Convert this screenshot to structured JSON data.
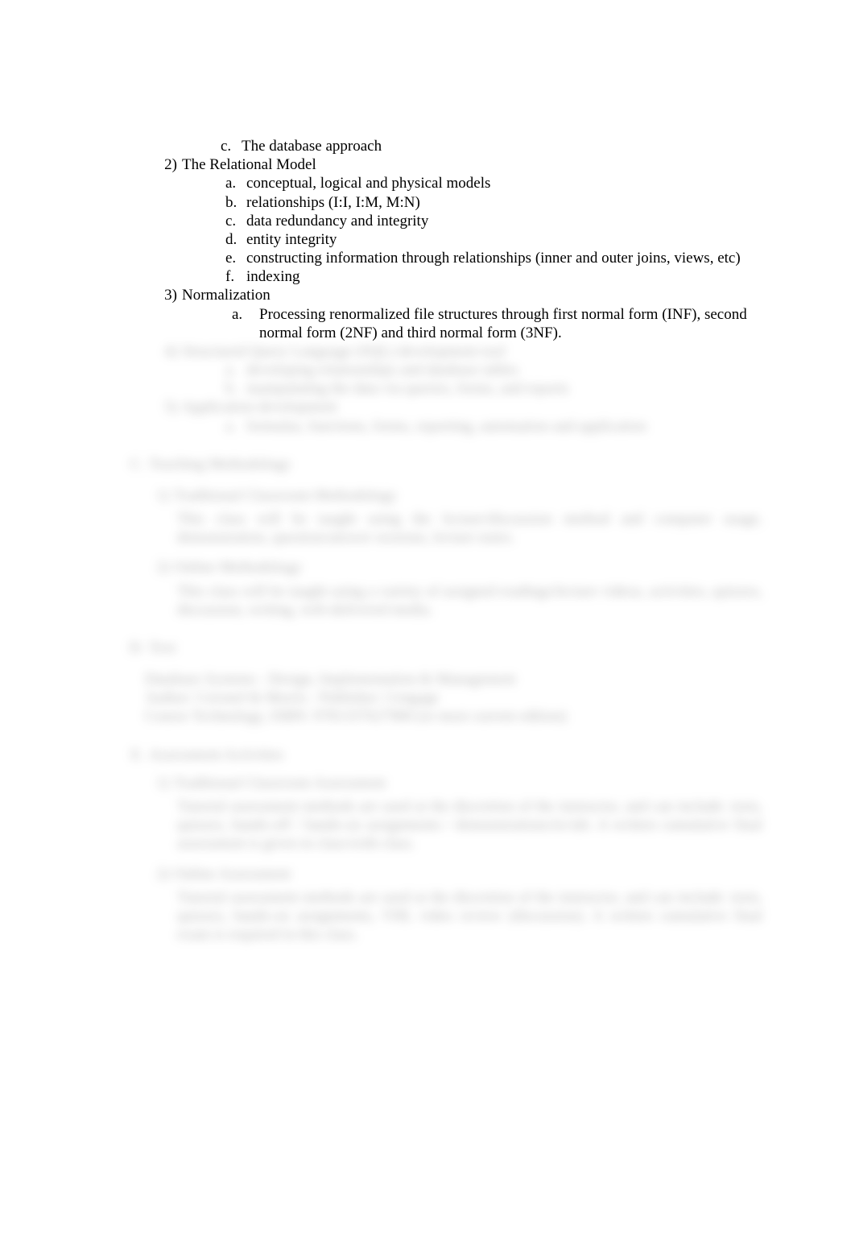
{
  "item1c": {
    "letter": "c.",
    "text": "The database approach"
  },
  "item2": {
    "num": "2)",
    "title": "The Relational Model",
    "subs": {
      "a": {
        "letter": "a.",
        "text": "conceptual, logical and physical models"
      },
      "b": {
        "letter": "b.",
        "text": "relationships (I:I, I:M, M:N)"
      },
      "c": {
        "letter": "c.",
        "text": "data redundancy and integrity"
      },
      "d": {
        "letter": "d.",
        "text": "entity integrity"
      },
      "e": {
        "letter": "e.",
        "text": "constructing information through relationships (inner and outer joins, views, etc)"
      },
      "f": {
        "letter": "f.",
        "text": "indexing"
      }
    }
  },
  "item3": {
    "num": "3)",
    "title": "Normalization",
    "subs": {
      "a": {
        "letter": "a.",
        "text": "Processing renormalized file structures through first normal form (INF), second normal form (2NF) and third normal form (3NF)."
      }
    }
  },
  "blurred": {
    "item4": {
      "num": "4)",
      "title": "Structured Query Language (SQL) development tool",
      "subs": {
        "a": "developing relationships and database tables",
        "b": "manipulating the data via queries, forms, and reports"
      }
    },
    "item5": {
      "num": "5)",
      "title": "Application development",
      "subs": {
        "a": "formulas, functions, forms, reporting, automation and application"
      }
    },
    "sectionC": {
      "label": "C.",
      "title": "Teaching Methodology",
      "item1": {
        "num": "1)",
        "title": "Traditional Classroom Methodology",
        "para": "This class will be taught using the lecture/discussion method and computer usage, demonstration, question/answer sessions, lecture notes."
      },
      "item2": {
        "num": "2)",
        "title": "Online Methodology",
        "para": "This class will be taught using a variety of assigned readings/lecture videos, activities, quizzes, discussion, writing, web-delivered media."
      }
    },
    "sectionD": {
      "label": "D.",
      "title": "Text",
      "line1": "Database Systems - Design, Implementation & Management",
      "line2": "Author: Coronel & Morris - Publisher: Cengage",
      "line3": "Course Technology, ISBN: 9781337627900   (or most current edition)"
    },
    "sectionE": {
      "label": "E.",
      "title": "Assessment Activities",
      "item1": {
        "num": "1)",
        "title": "Traditional Classroom Assessment",
        "para": "Tutorial assessment methods are used at the discretion of the instructor, and can include: tests, quizzes, hands-off / hands-on assignments / demonstrations/in-lab. A written cumulative final assessment is given in class/with class."
      },
      "item2": {
        "num": "2)",
        "title": "Online Assessment",
        "para": "Tutorial assessment methods are used at the discretion of the instructor, and can include: tests, quizzes, hands-on assignments, VHL video review (discussion). A written cumulative final exam is required in this class."
      }
    }
  }
}
